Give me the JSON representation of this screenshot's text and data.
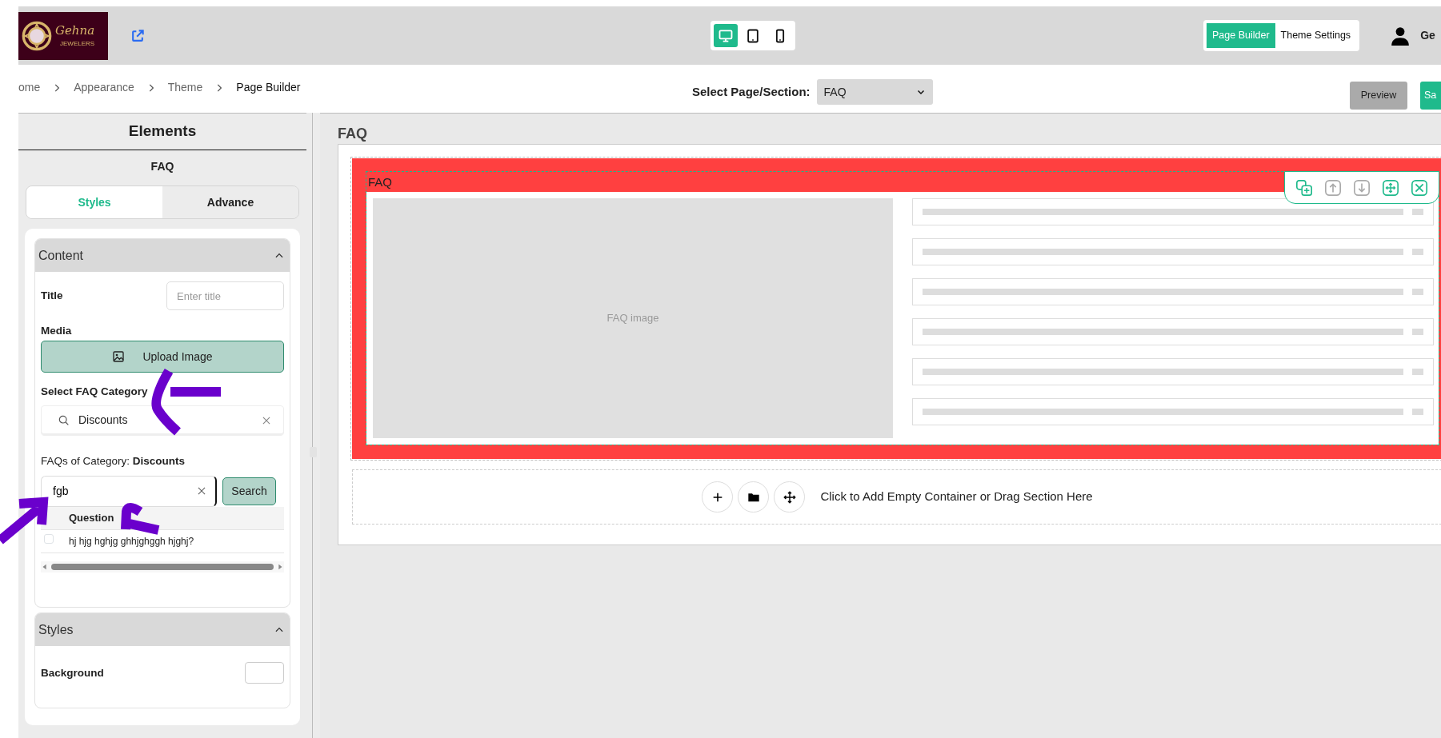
{
  "header": {
    "logo": {
      "name": "Gehna",
      "tagline": "JEWELERS"
    },
    "device_modes": [
      {
        "kind": "desktop",
        "selected": true
      },
      {
        "kind": "tablet",
        "selected": false
      },
      {
        "kind": "mobile",
        "selected": false
      }
    ],
    "mode_tabs": [
      {
        "label": "Page Builder",
        "selected": true
      },
      {
        "label": "Theme Settings",
        "selected": false
      }
    ],
    "user_name": "Ge"
  },
  "breadcrumb": [
    "ome",
    "Appearance",
    "Theme",
    "Page Builder"
  ],
  "page_select": {
    "label": "Select Page/Section:",
    "value": "FAQ"
  },
  "actions": [
    {
      "label": "Preview",
      "kind": "secondary"
    },
    {
      "label": "Sa",
      "kind": "primary"
    }
  ],
  "sidebar": {
    "title": "Elements",
    "element": "FAQ",
    "tabs": [
      {
        "label": "Styles",
        "selected": true
      },
      {
        "label": "Advance",
        "selected": false
      }
    ],
    "content": {
      "title": "Content",
      "expanded": true,
      "title_field": {
        "label": "Title",
        "placeholder": "Enter title"
      },
      "media_label": "Media",
      "upload_button": "Upload Image",
      "category_label": "Select FAQ Category",
      "category_value": "Discounts",
      "faqs_label": "FAQs of Category: **Discounts**",
      "search_value": "fgb",
      "search_button": "Search",
      "table": {
        "columns": [
          "Question"
        ],
        "rows": [
          {
            "question": "hj hjg hghjg ghhjghggh hjghj?",
            "checked": false
          }
        ]
      }
    },
    "styles": {
      "title": "Styles",
      "expanded": true,
      "background_label": "Background"
    }
  },
  "canvas": {
    "title": "FAQ",
    "section": {
      "label": "FAQ",
      "image_label": "FAQ image",
      "faq_placeholders": [
        {
          "kind": "skeleton"
        },
        {
          "kind": "skeleton"
        },
        {
          "kind": "skeleton"
        },
        {
          "kind": "skeleton"
        },
        {
          "kind": "skeleton"
        },
        {
          "kind": "skeleton"
        }
      ],
      "tools": [
        {
          "kind": "duplicate",
          "disabled": false
        },
        {
          "kind": "up",
          "disabled": true
        },
        {
          "kind": "down",
          "disabled": true
        },
        {
          "kind": "move",
          "disabled": false
        },
        {
          "kind": "delete",
          "disabled": false
        }
      ]
    },
    "add_prompt": "Click to Add Empty Container or Drag Section Here",
    "add_actions": [
      {
        "kind": "add"
      },
      {
        "kind": "folder"
      },
      {
        "kind": "move"
      }
    ]
  }
}
